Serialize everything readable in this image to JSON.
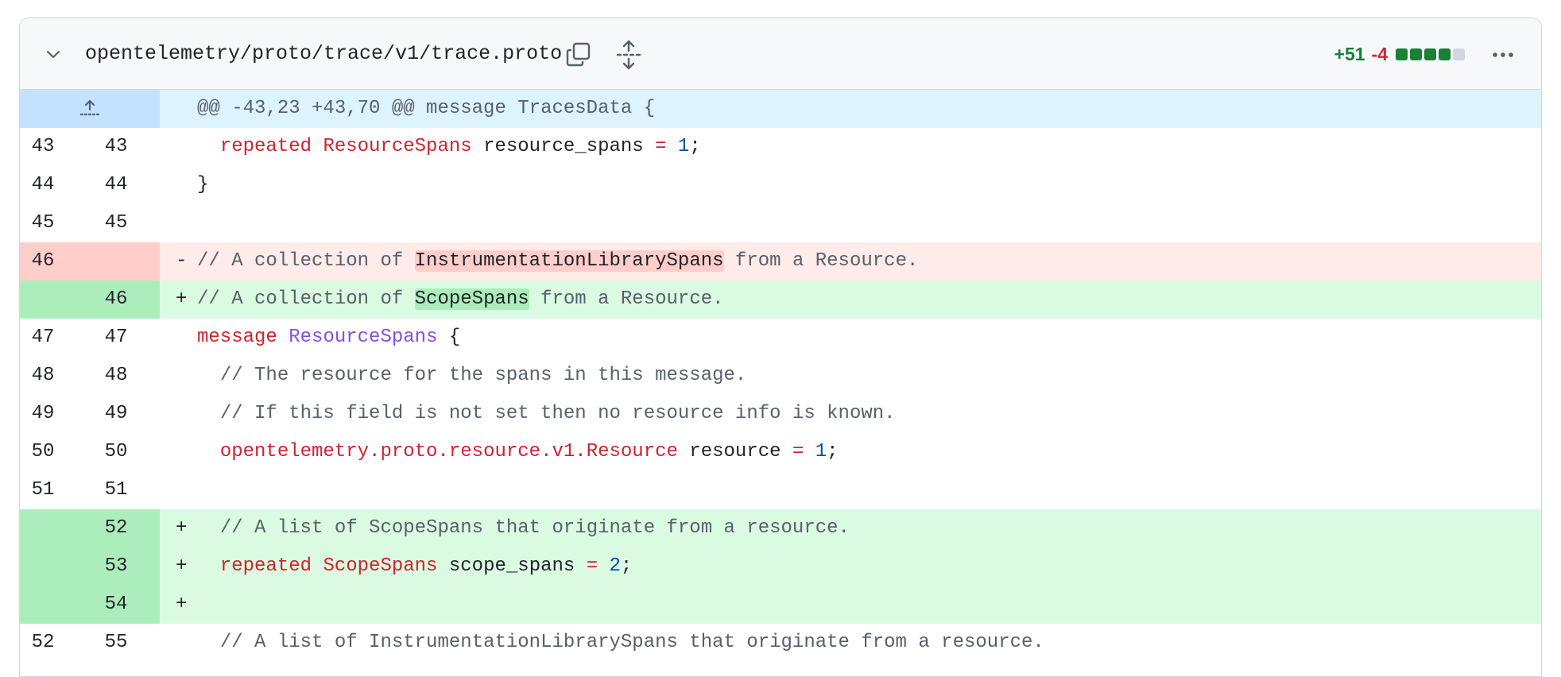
{
  "file": {
    "path": "opentelemetry/proto/trace/v1/trace.proto",
    "additions": "+51",
    "deletions": "-4",
    "diffstat_colors": [
      "#1a7f37",
      "#1a7f37",
      "#1a7f37",
      "#1a7f37",
      "#d0d7de"
    ]
  },
  "icons": {
    "collapse": "chevron-down-icon",
    "copy": "copy-icon",
    "expand": "unfold-icon",
    "more": "kebab-horizontal-icon",
    "expand_up": "fold-up-icon"
  },
  "hunk_header": "@@ -43,23 +43,70 @@ message TracesData {",
  "lines": [
    {
      "old": "43",
      "new": "43",
      "type": "ctx",
      "marker": " ",
      "tokens": [
        {
          "t": "  "
        },
        {
          "t": "repeated",
          "c": "kw"
        },
        {
          "t": " "
        },
        {
          "t": "ResourceSpans",
          "c": "kw"
        },
        {
          "t": " resource_spans "
        },
        {
          "t": "=",
          "c": "kw"
        },
        {
          "t": " "
        },
        {
          "t": "1",
          "c": "nb"
        },
        {
          "t": ";"
        }
      ]
    },
    {
      "old": "44",
      "new": "44",
      "type": "ctx",
      "marker": " ",
      "tokens": [
        {
          "t": "}"
        }
      ]
    },
    {
      "old": "45",
      "new": "45",
      "type": "ctx",
      "marker": " ",
      "tokens": []
    },
    {
      "old": "46",
      "new": "",
      "type": "del",
      "marker": "-",
      "tokens": [
        {
          "t": "// A collection of ",
          "c": "cm"
        },
        {
          "t": "InstrumentationLibrarySpans",
          "c": "hl-del"
        },
        {
          "t": " from a Resource.",
          "c": "cm"
        }
      ]
    },
    {
      "old": "",
      "new": "46",
      "type": "add",
      "marker": "+",
      "tokens": [
        {
          "t": "// A collection of ",
          "c": "cm"
        },
        {
          "t": "ScopeSpans",
          "c": "hl-add"
        },
        {
          "t": " from a Resource.",
          "c": "cm"
        }
      ]
    },
    {
      "old": "47",
      "new": "47",
      "type": "ctx",
      "marker": " ",
      "tokens": [
        {
          "t": "message",
          "c": "kw"
        },
        {
          "t": " "
        },
        {
          "t": "ResourceSpans",
          "c": "ty"
        },
        {
          "t": " {"
        }
      ]
    },
    {
      "old": "48",
      "new": "48",
      "type": "ctx",
      "marker": " ",
      "tokens": [
        {
          "t": "  "
        },
        {
          "t": "// The resource for the spans in this message.",
          "c": "cm"
        }
      ]
    },
    {
      "old": "49",
      "new": "49",
      "type": "ctx",
      "marker": " ",
      "tokens": [
        {
          "t": "  "
        },
        {
          "t": "// If this field is not set then no resource info is known.",
          "c": "cm"
        }
      ]
    },
    {
      "old": "50",
      "new": "50",
      "type": "ctx",
      "marker": " ",
      "tokens": [
        {
          "t": "  "
        },
        {
          "t": "opentelemetry.proto.resource.v1.Resource",
          "c": "kw"
        },
        {
          "t": " resource "
        },
        {
          "t": "=",
          "c": "kw"
        },
        {
          "t": " "
        },
        {
          "t": "1",
          "c": "nb"
        },
        {
          "t": ";"
        }
      ]
    },
    {
      "old": "51",
      "new": "51",
      "type": "ctx",
      "marker": " ",
      "tokens": []
    },
    {
      "old": "",
      "new": "52",
      "type": "add",
      "marker": "+",
      "tokens": [
        {
          "t": "  "
        },
        {
          "t": "// A list of ScopeSpans that originate from a resource.",
          "c": "cm"
        }
      ]
    },
    {
      "old": "",
      "new": "53",
      "type": "add",
      "marker": "+",
      "tokens": [
        {
          "t": "  "
        },
        {
          "t": "repeated",
          "c": "kw"
        },
        {
          "t": " "
        },
        {
          "t": "ScopeSpans",
          "c": "kw"
        },
        {
          "t": " scope_spans "
        },
        {
          "t": "=",
          "c": "kw"
        },
        {
          "t": " "
        },
        {
          "t": "2",
          "c": "nb"
        },
        {
          "t": ";"
        }
      ]
    },
    {
      "old": "",
      "new": "54",
      "type": "add",
      "marker": "+",
      "tokens": []
    },
    {
      "old": "52",
      "new": "55",
      "type": "ctx",
      "marker": " ",
      "tokens": [
        {
          "t": "  "
        },
        {
          "t": "// A list of InstrumentationLibrarySpans that originate from a resource.",
          "c": "cm"
        }
      ]
    }
  ]
}
